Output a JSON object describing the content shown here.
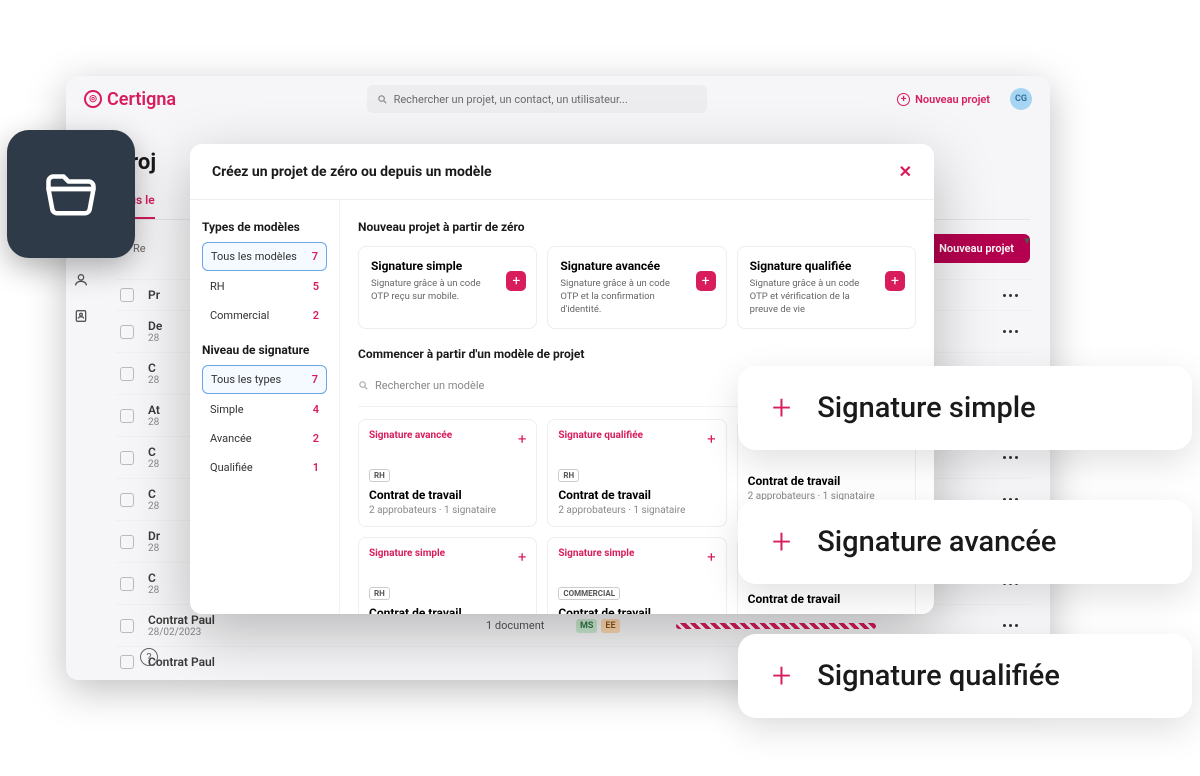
{
  "header": {
    "brand": "Certigna",
    "search_placeholder": "Rechercher un projet, un contact, un utilisateur...",
    "new_project": "Nouveau projet",
    "avatar": "CG"
  },
  "page": {
    "title": "Proj",
    "tab_all": "Tous le"
  },
  "filter": {
    "search_placeholder": "Re",
    "button": "Nouveau projet"
  },
  "projects": [
    {
      "name": "Pr",
      "date": ""
    },
    {
      "name": "De",
      "date": "28"
    },
    {
      "name": "C",
      "date": "28"
    },
    {
      "name": "At",
      "date": "28"
    },
    {
      "name": "C",
      "date": "28"
    },
    {
      "name": "C",
      "date": "28"
    },
    {
      "name": "Dr",
      "date": "28"
    },
    {
      "name": "C",
      "date": "28"
    },
    {
      "name": "Contrat Paul",
      "date": "28/02/2023",
      "docs": "1 document",
      "ms": "MS",
      "ee": "EE"
    },
    {
      "name": "Contrat Paul",
      "date": ""
    }
  ],
  "modal": {
    "title": "Créez un projet de zéro ou depuis un modèle",
    "types_title": "Types de modèles",
    "types": [
      {
        "label": "Tous les modèles",
        "count": "7",
        "active": true
      },
      {
        "label": "RH",
        "count": "5"
      },
      {
        "label": "Commercial",
        "count": "2"
      }
    ],
    "levels_title": "Niveau de signature",
    "levels": [
      {
        "label": "Tous les types",
        "count": "7",
        "active": true
      },
      {
        "label": "Simple",
        "count": "4"
      },
      {
        "label": "Avancée",
        "count": "2"
      },
      {
        "label": "Qualifiée",
        "count": "1"
      }
    ],
    "section_from_zero": "Nouveau projet à partir de zéro",
    "sig_cards": [
      {
        "title": "Signature simple",
        "desc": "Signature grâce à un code OTP reçu sur mobile."
      },
      {
        "title": "Signature avancée",
        "desc": "Signature grâce à un code OTP et la confirmation d'identité."
      },
      {
        "title": "Signature qualifiée",
        "desc": "Signature grâce à un code OTP et vérification de la preuve de vie"
      }
    ],
    "section_templates": "Commencer à partir d'un modèle de projet",
    "template_search": "Rechercher un modèle",
    "templates": [
      {
        "type": "Signature avancée",
        "tag": "RH",
        "name": "Contrat de travail",
        "meta": "2 approbateurs · 1 signataire"
      },
      {
        "type": "Signature qualifiée",
        "tag": "RH",
        "name": "Contrat de travail",
        "meta": "2 approbateurs · 1 signataire"
      },
      {
        "type": "",
        "tag": "",
        "name": "Contrat de travail",
        "meta": "2 approbateurs · 1 signataire"
      },
      {
        "type": "Signature simple",
        "tag": "RH",
        "name": "Contrat de travail",
        "meta": ""
      },
      {
        "type": "Signature simple",
        "tag": "COMMERCIAL",
        "name": "Contrat de travail",
        "meta": ""
      },
      {
        "type": "",
        "tag": "",
        "name": "Contrat de travail",
        "meta": ""
      }
    ]
  },
  "float": {
    "simple": "Signature simple",
    "avancee": "Signature avancée",
    "qualifiee": "Signature qualifiée"
  }
}
